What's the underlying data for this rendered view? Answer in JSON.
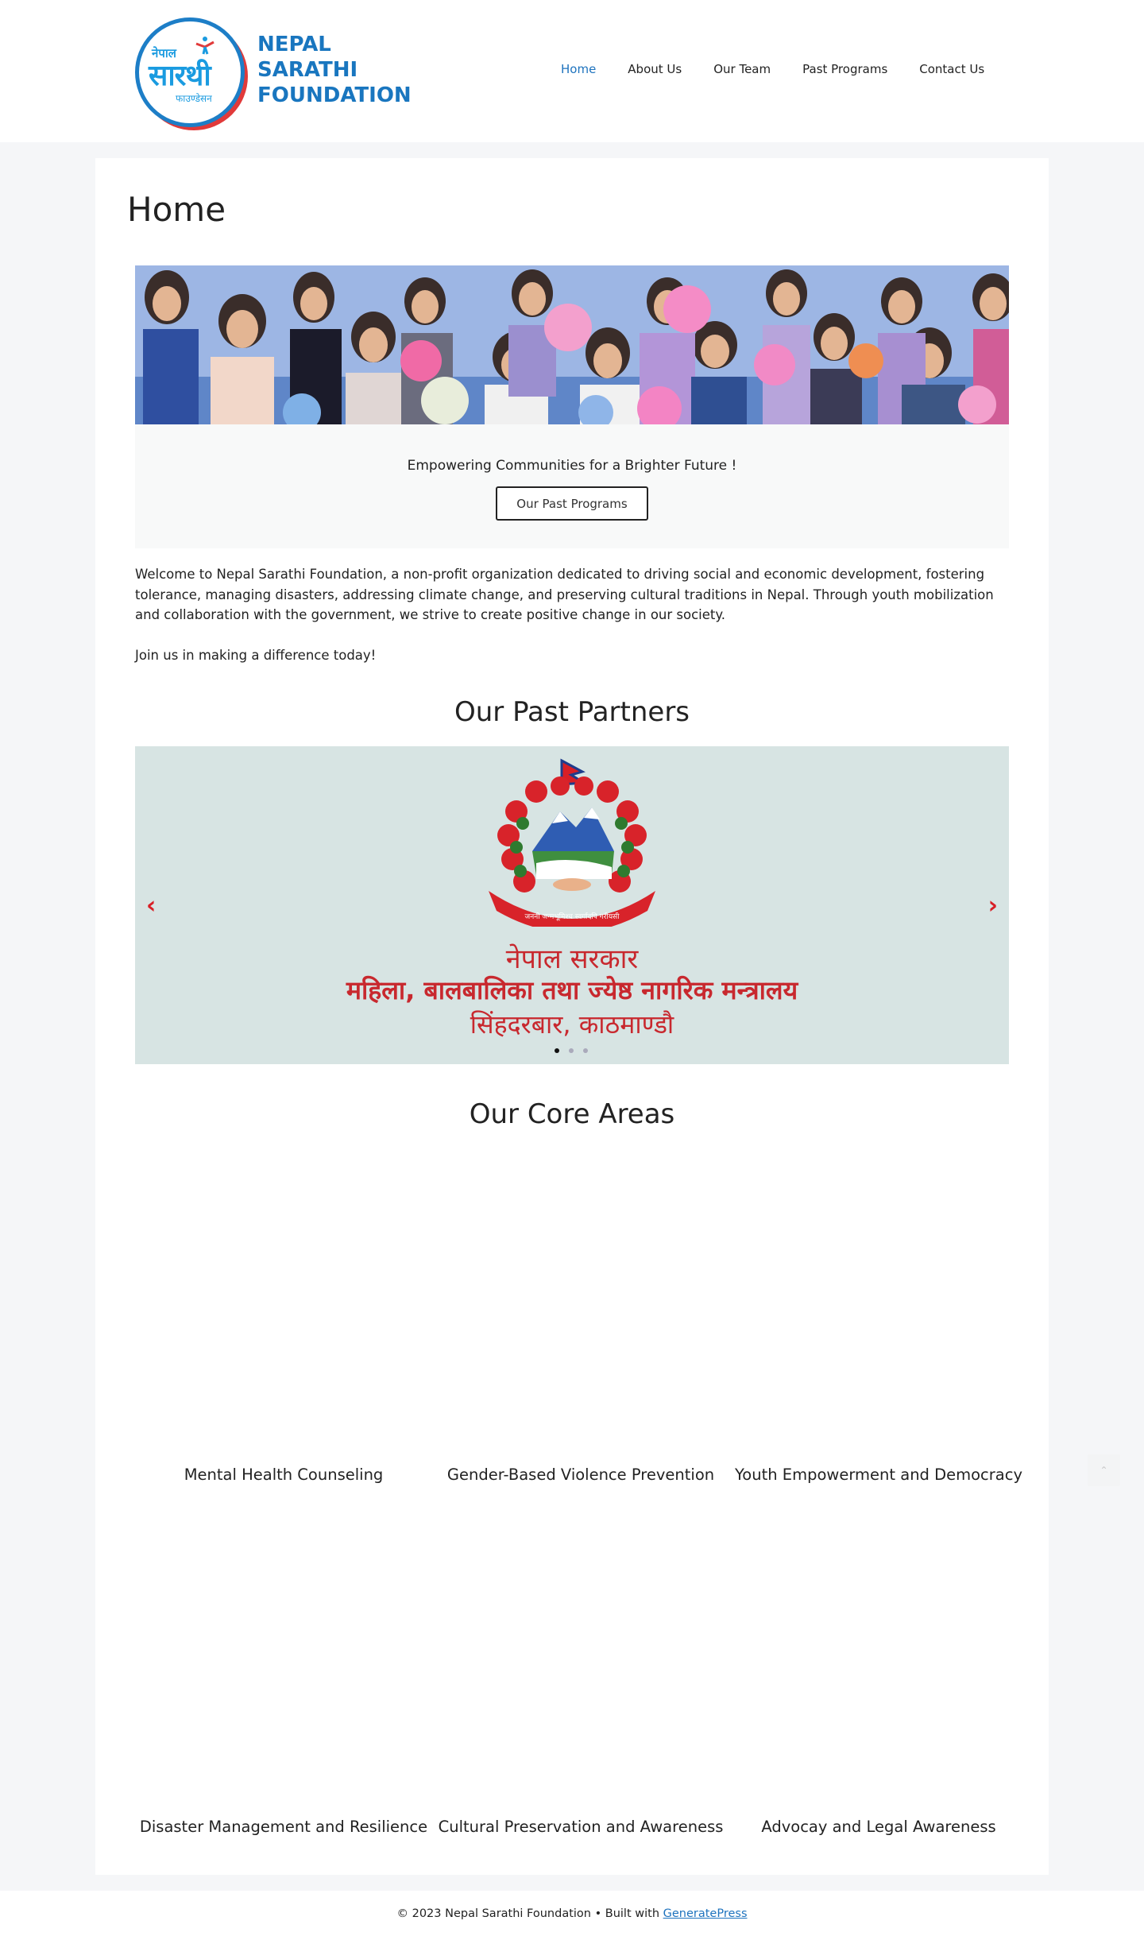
{
  "header": {
    "logo_devanagari_top": "नेपाल",
    "logo_devanagari_main": "सारथी",
    "logo_devanagari_sub": "फाउण्डेसन",
    "brand_line1": "NEPAL",
    "brand_line2": "SARATHI",
    "brand_line3": "FOUNDATION",
    "nav": [
      "Home",
      "About Us",
      "Our Team",
      "Past Programs",
      "Contact Us"
    ],
    "active_nav": "Home"
  },
  "page": {
    "title": "Home"
  },
  "hero": {
    "tagline": "Empowering Communities for a Brighter Future !",
    "button_label": "Our Past Programs"
  },
  "intro": {
    "paragraph1": "Welcome to Nepal Sarathi Foundation, a non-profit organization dedicated to driving social and economic development, fostering tolerance, managing disasters, addressing climate change, and preserving cultural traditions in Nepal. Through youth mobilization and collaboration with the government, we strive to create positive change in our society.",
    "paragraph2": "Join us in making a difference today!"
  },
  "partners": {
    "heading": "Our Past Partners",
    "slide_line1": "नेपाल सरकार",
    "slide_line2": "महिला, बालबालिका तथा ज्येष्ठ नागरिक मन्त्रालय",
    "slide_line3": "सिंहदरबार, काठमाण्डौ",
    "emblem_motto": "जननी जन्मभूमिश्च स्वर्गादपि गरीयसी",
    "prev_arrow": "‹",
    "next_arrow": "›",
    "active_slide": 1,
    "slide_count": 3
  },
  "core_areas": {
    "heading": "Our Core Areas",
    "items": [
      "Mental Health Counseling",
      "Gender-Based Violence Prevention",
      "Youth Empowerment and Democracy",
      "Disaster Management and Resilience",
      "Cultural Preservation and Awareness",
      "Advocay and Legal Awareness"
    ]
  },
  "footer": {
    "text": "© 2023 Nepal Sarathi Foundation • Built with ",
    "link": "GeneratePress"
  },
  "colors": {
    "brand_blue": "#1976bf",
    "nav_active": "#1e73be",
    "accent_red": "#d81f26",
    "page_bg": "#f5f6f8"
  }
}
